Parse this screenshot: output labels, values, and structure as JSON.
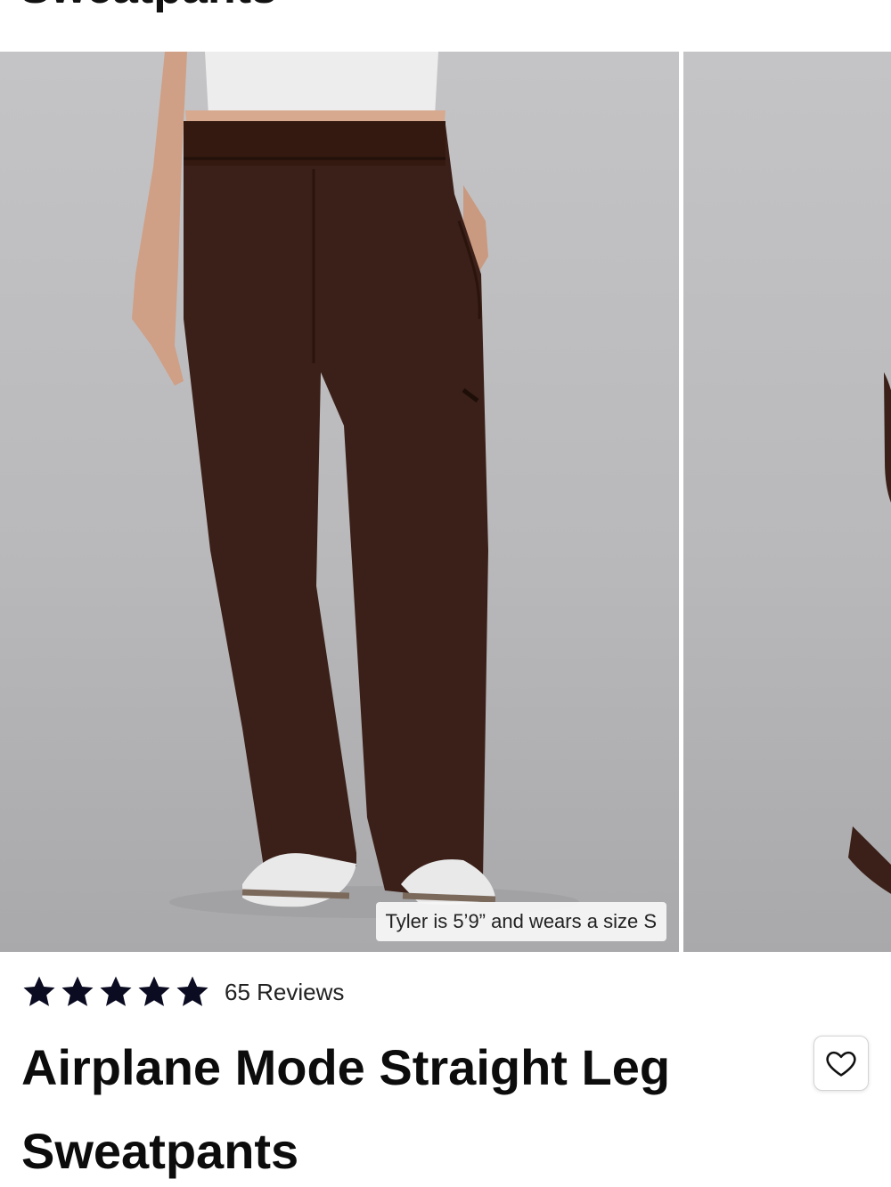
{
  "header": {
    "title_peek": "Sweatpants"
  },
  "gallery": {
    "slides": [
      {
        "subject": "model wearing brown straight leg sweatpants, front view"
      },
      {
        "subject": "model wearing brown sweatpants, partial view"
      }
    ],
    "caption": "Tyler is 5’9” and wears a size S"
  },
  "product": {
    "rating_stars": 5,
    "reviews_label": "65 Reviews",
    "title": "Airplane Mode Straight Leg Sweatpants"
  },
  "icons": {
    "star": "star-icon",
    "wishlist": "heart-icon"
  },
  "colors": {
    "pants": "#3b2019",
    "background_studio": "#bdbdbf",
    "star": "#0b0b22",
    "text": "#0c0c0c"
  }
}
